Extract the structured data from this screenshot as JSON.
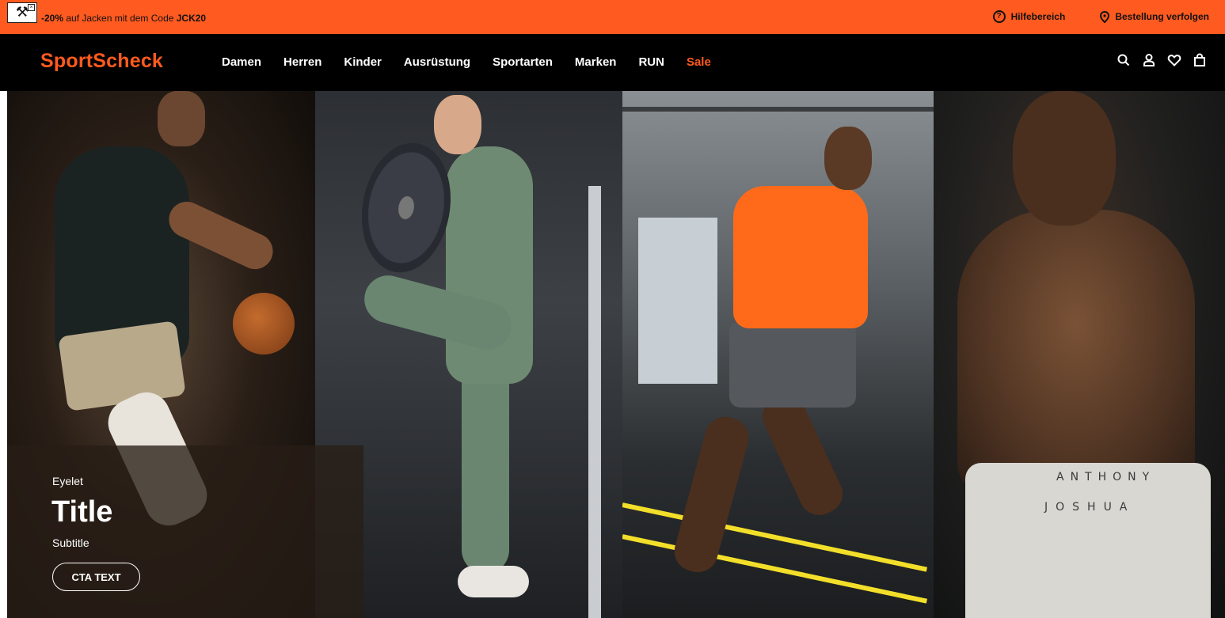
{
  "promo": {
    "discount": "-20%",
    "text_middle": " auf Jacken mit dem Code ",
    "code": "JCK20",
    "links": [
      {
        "label": "Hilfebereich",
        "icon": "help-circle-icon"
      },
      {
        "label": "Bestellung verfolgen",
        "icon": "location-pin-icon"
      }
    ]
  },
  "header": {
    "logo": "SportScheck",
    "nav": [
      "Damen",
      "Herren",
      "Kinder",
      "Ausrüstung",
      "Sportarten",
      "Marken",
      "RUN",
      "Sale"
    ],
    "icons": [
      "search-icon",
      "account-icon",
      "wishlist-heart-icon",
      "cart-bag-icon"
    ]
  },
  "hero": {
    "eyelet": "Eyelet",
    "title": "Title",
    "subtitle": "Subtitle",
    "cta": "CTA TEXT",
    "panel4_brand_line1": "ANTHONY",
    "panel4_brand_line2": "JOSHUA"
  },
  "colors": {
    "accent": "#ff5a1f",
    "header_bg": "#000000",
    "annotation_arrow": "#e8141c"
  }
}
